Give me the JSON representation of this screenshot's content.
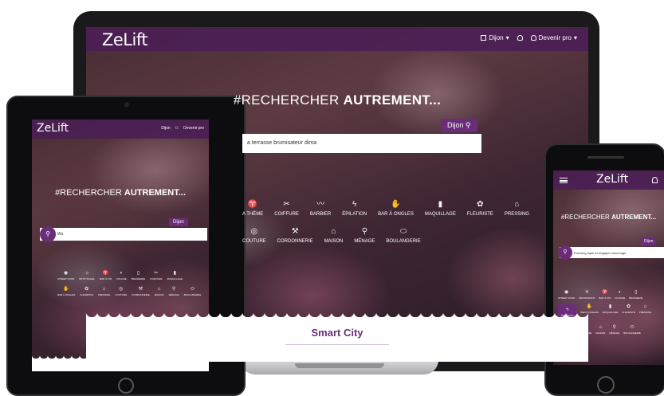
{
  "brand": {
    "logo": "ZeLift",
    "accent": "#6b2d7a"
  },
  "laptop": {
    "nav": {
      "city": "Dijon",
      "pro": "Devenir pro"
    },
    "hero_title_prefix": "#RECHERCHER",
    "hero_title_bold": "AUTREMENT...",
    "city_tag": "Dijon",
    "search_value": "a terrasse brumisateur dima",
    "categories_row1": [
      "A THÈME",
      "COIFFURE",
      "BARBIER",
      "ÉPILATION",
      "BAR À ONGLES",
      "MAQUILLAGE",
      "FLEURISTE",
      "PRESSING"
    ],
    "categories_row2": [
      "COUTURE",
      "CORDONNERIE",
      "MAISON",
      "MÉNAGE",
      "BOULANGERIE"
    ],
    "section_title": "Smart City"
  },
  "tablet": {
    "logo": "ZeLift",
    "nav": {
      "city": "Dijon",
      "pro": "Devenir pro"
    },
    "hero_title_prefix": "#RECHERCHER",
    "hero_title_bold": "AUTREMENT...",
    "city_tag": "Dijon",
    "search_value": "Wu",
    "categories_row1": [
      "STREET FOOD",
      "PETIT SOLEIL",
      "BAR À VIN",
      "COUCHE",
      "BRASSERIE",
      "COIFFURE",
      "MAQUILLAGE"
    ],
    "categories_row2": [
      "BAR À ONGLES",
      "FLEURISTE",
      "PRESSING",
      "COUTURE",
      "CORDONNERIE",
      "MAISON",
      "MÉNAGE",
      "BOULANGERIE"
    ]
  },
  "phone": {
    "logo": "ZeLift",
    "hero_title_prefix": "#RECHERCHER",
    "hero_title_bold": "AUTREMENT...",
    "city_tag": "Dijon",
    "search_value": "Pressing lapin écologique lomumage",
    "categories_row1": [
      "STREET FOOD",
      "RESTAURANT",
      "BAR À VIN",
      "COUCHE",
      "BRASSERIE"
    ],
    "categories_row2": [
      "ÉPILATION",
      "BAR À ONGLES",
      "MAQUILLAGE",
      "FLEURISTE",
      "PRESSING"
    ],
    "categories_row3": [
      "COUTURE",
      "CORDONNERIE",
      "MAISON",
      "MÉNAGE",
      "BOULANGERIE"
    ]
  }
}
